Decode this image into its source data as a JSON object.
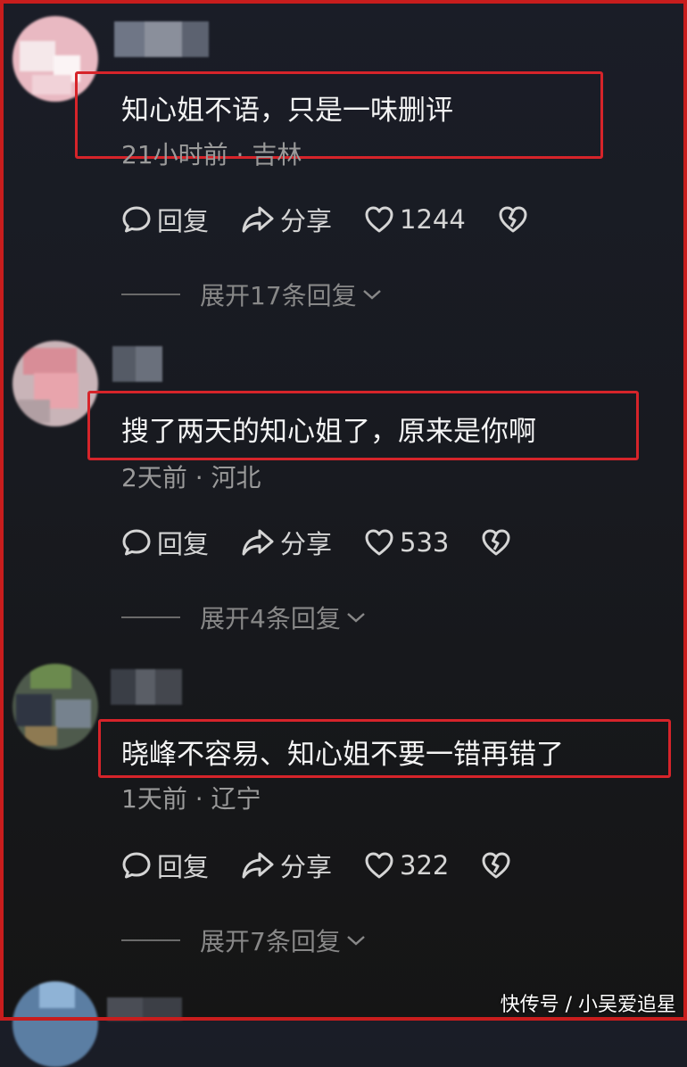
{
  "comments": [
    {
      "text": "知心姐不语，只是一味删评",
      "meta": "21小时前 · 吉林",
      "reply_label": "回复",
      "share_label": "分享",
      "likes": "1244",
      "expand_label": "展开17条回复"
    },
    {
      "text": "搜了两天的知心姐了，原来是你啊",
      "meta": "2天前 · 河北",
      "reply_label": "回复",
      "share_label": "分享",
      "likes": "533",
      "expand_label": "展开4条回复"
    },
    {
      "text": "晓峰不容易、知心姐不要一错再错了",
      "meta": "1天前 · 辽宁",
      "reply_label": "回复",
      "share_label": "分享",
      "likes": "322",
      "expand_label": "展开7条回复"
    }
  ],
  "icons": {
    "reply": "comment-bubble-icon",
    "share": "share-arrow-icon",
    "like": "heart-icon",
    "dislike": "broken-heart-icon",
    "expand": "chevron-down-icon"
  },
  "colors": {
    "highlight": "#d6242a",
    "frame": "#c81d1d"
  },
  "watermark": "快传号 / 小吴爱追星"
}
